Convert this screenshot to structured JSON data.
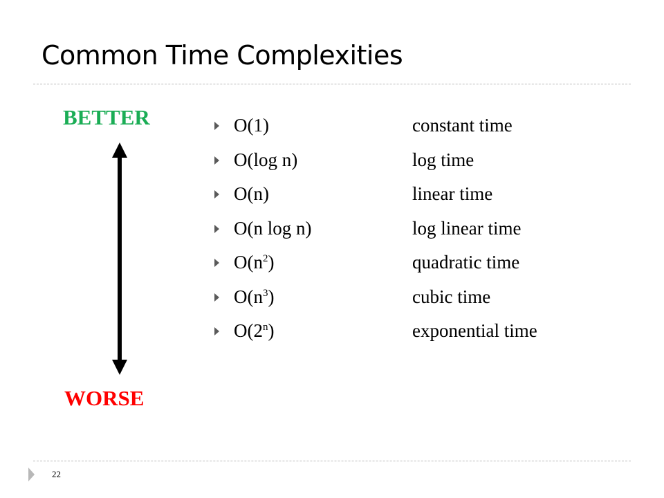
{
  "slide": {
    "title": "Common Time Complexities",
    "page_number": "22"
  },
  "scale": {
    "top_label": "BETTER",
    "bottom_label": "WORSE",
    "top_color": "#1aad55",
    "bottom_color": "#ff0000",
    "arrow_icon": "double-headed-vertical-arrow"
  },
  "complexities": [
    {
      "base": "O(1)",
      "sup": "",
      "close": "",
      "description": "constant time"
    },
    {
      "base": "O(log n)",
      "sup": "",
      "close": "",
      "description": "log time"
    },
    {
      "base": "O(n)",
      "sup": "",
      "close": "",
      "description": "linear time"
    },
    {
      "base": "O(n log n)",
      "sup": "",
      "close": "",
      "description": "log linear time"
    },
    {
      "base": "O(n",
      "sup": "2",
      "close": ")",
      "description": "quadratic time"
    },
    {
      "base": "O(n",
      "sup": "3",
      "close": ")",
      "description": "cubic time"
    },
    {
      "base": "O(2",
      "sup": "n",
      "close": ")",
      "description": "exponential time"
    }
  ]
}
